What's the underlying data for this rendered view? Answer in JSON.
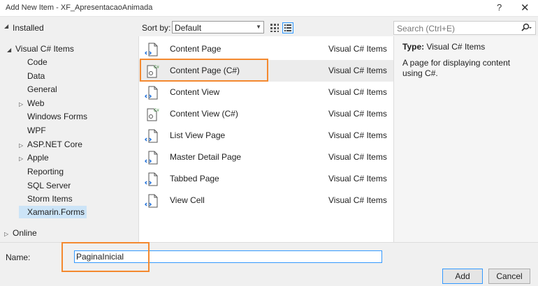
{
  "window": {
    "title": "Add New Item - XF_ApresentacaoAnimada",
    "help": "?",
    "close": "✕"
  },
  "left": {
    "header": "Installed",
    "tree": [
      {
        "label": "Visual C# Items",
        "exp": "◢"
      },
      {
        "label": "Code",
        "exp": ""
      },
      {
        "label": "Data",
        "exp": ""
      },
      {
        "label": "General",
        "exp": ""
      },
      {
        "label": "Web",
        "exp": "▷"
      },
      {
        "label": "Windows Forms",
        "exp": ""
      },
      {
        "label": "WPF",
        "exp": ""
      },
      {
        "label": "ASP.NET Core",
        "exp": "▷"
      },
      {
        "label": "Apple",
        "exp": "▷"
      },
      {
        "label": "Reporting",
        "exp": ""
      },
      {
        "label": "SQL Server",
        "exp": ""
      },
      {
        "label": "Storm Items",
        "exp": ""
      },
      {
        "label": "Xamarin.Forms",
        "exp": ""
      }
    ],
    "online": "Online",
    "online_exp": "▷",
    "header_exp": "◢"
  },
  "toolbar": {
    "sort_label": "Sort by:",
    "sort_value": "Default",
    "search_placeholder": "Search (Ctrl+E)"
  },
  "items": [
    {
      "name": "Content Page",
      "lang": "Visual C# Items"
    },
    {
      "name": "Content Page (C#)",
      "lang": "Visual C# Items"
    },
    {
      "name": "Content View",
      "lang": "Visual C# Items"
    },
    {
      "name": "Content View (C#)",
      "lang": "Visual C# Items"
    },
    {
      "name": "List View Page",
      "lang": "Visual C# Items"
    },
    {
      "name": "Master Detail Page",
      "lang": "Visual C# Items"
    },
    {
      "name": "Tabbed Page",
      "lang": "Visual C# Items"
    },
    {
      "name": "View Cell",
      "lang": "Visual C# Items"
    }
  ],
  "details": {
    "type_label": "Type:",
    "type_value": "Visual C# Items",
    "description": "A page for displaying content using C#."
  },
  "namebar": {
    "label": "Name:",
    "value": "PaginaInicial",
    "add": "Add",
    "cancel": "Cancel"
  },
  "colors": {
    "accent": "#3399ff",
    "highlight": "#f4892f",
    "selected_row": "#ececec",
    "selected_tree": "#cce4f7"
  },
  "icons": {
    "cs_badge": "C#"
  }
}
